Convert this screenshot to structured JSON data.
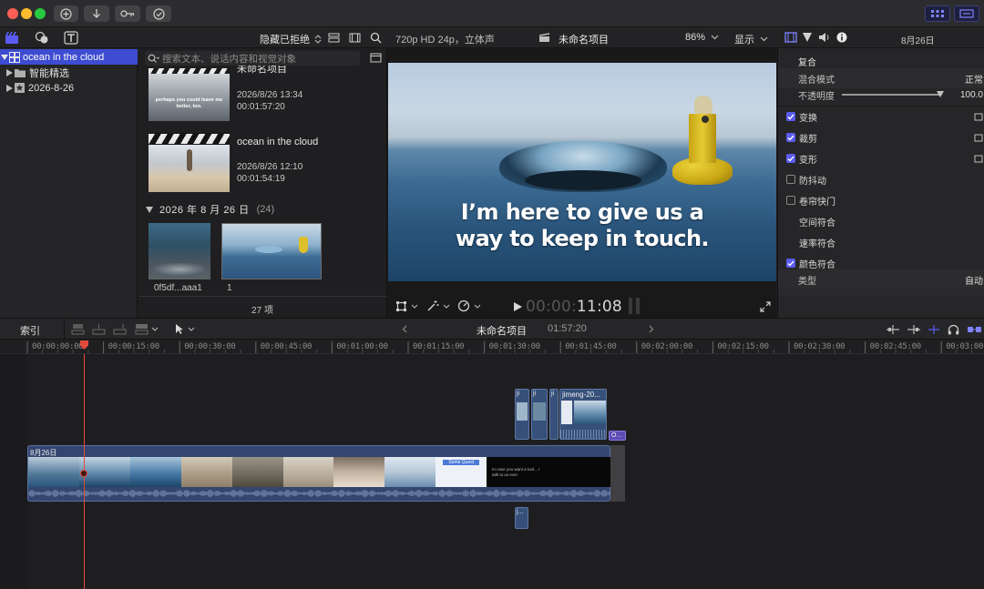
{
  "browser": {
    "filter_label": "隐藏已拒绝",
    "search_placeholder": "搜索文本、说话内容和视觉对象",
    "clips": [
      {
        "title": "未命名项目",
        "date": "2026/8/26 13:34",
        "duration": "00:01:57:20",
        "thumb_caption": "perhaps you could leave me better, too."
      },
      {
        "title": "ocean in the cloud",
        "date": "2026/8/26 12:10",
        "duration": "00:01:54:19"
      }
    ],
    "group_header": "2026 年 8 月 26 日",
    "group_count": "(24)",
    "grid_clips": [
      {
        "label": "0f5df...aaa1"
      },
      {
        "label": "1"
      }
    ],
    "item_count": "27 项"
  },
  "colors": {
    "accent": "#5a5cf0",
    "playhead": "#e24a3a",
    "selection": "#3d4cd0"
  },
  "inspector": {
    "date": "8月26日",
    "section": "复合",
    "blend_label": "混合模式",
    "blend_value": "正常",
    "opacity_label": "不透明度",
    "opacity_value": "100.0",
    "opacity_level": 1.0,
    "rows": [
      {
        "label": "变换",
        "checked": true
      },
      {
        "label": "裁剪",
        "checked": true
      },
      {
        "label": "变形",
        "checked": true
      },
      {
        "label": "防抖动",
        "checked": false
      },
      {
        "label": "卷帘快门",
        "checked": false
      },
      {
        "label": "空间符合",
        "checked": null
      },
      {
        "label": "速率符合",
        "checked": null
      },
      {
        "label": "颜色符合",
        "checked": true
      }
    ],
    "type_label": "类型",
    "type_value": "自动"
  },
  "sidebar": {
    "items": [
      {
        "label": "ocean in the cloud",
        "selected": true
      },
      {
        "label": "智能精选"
      },
      {
        "label": "2026-8-26"
      }
    ]
  },
  "timeline": {
    "index_label": "索引",
    "project_name": "未命名项目",
    "project_duration": "01:57:20",
    "ruler": [
      "00:00:00:00",
      "00:00:15:00",
      "00:00:30:00",
      "00:00:45:00",
      "00:01:00:00",
      "00:01:15:00",
      "00:01:30:00",
      "00:01:45:00",
      "00:02:00:00",
      "00:02:15:00",
      "00:02:30:00",
      "00:02:45:00",
      "00:03:00"
    ],
    "date_badge": "8月26日",
    "connected_clip_title": "jimeng-20...",
    "connected_short": "ji",
    "connected_purple": "O...",
    "below_clip": "j...",
    "thumb_texts": [
      "Some Quest",
      "In case you want a tool... / talk to us ever"
    ]
  },
  "viewer": {
    "format": "720p HD 24p，立体声",
    "project_title": "未命名项目",
    "zoom": "86%",
    "zoom_value": 86,
    "display_label": "显示",
    "subtitle_line1": "I’m here to give us a",
    "subtitle_line2": "way to keep in touch.",
    "timecode_dim": "00:00:",
    "timecode_bright": "11:08"
  }
}
